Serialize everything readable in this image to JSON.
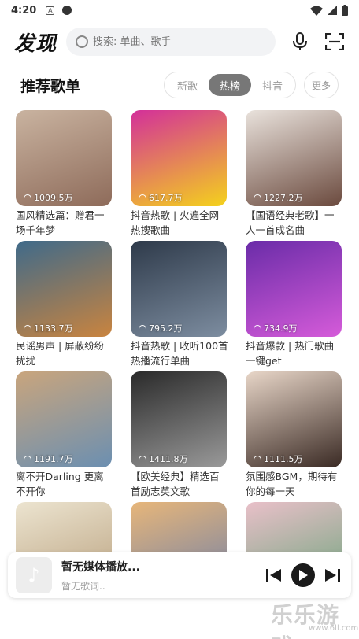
{
  "status": {
    "time": "4:20",
    "a_badge": "A"
  },
  "header": {
    "title": "发现",
    "search_placeholder": "搜索: 单曲、歌手"
  },
  "section": {
    "title": "推荐歌单",
    "tabs": [
      "新歌",
      "热榜",
      "抖音"
    ],
    "active_tab": "热榜",
    "more": "更多"
  },
  "playlists": [
    {
      "plays": "1009.5万",
      "title": "国风精选篇：赠君一场千年梦",
      "colors": [
        "#c9b3a0",
        "#8e6b5a"
      ]
    },
    {
      "plays": "617.7万",
      "title": "抖音热歌 | 火遍全网热搜歌曲",
      "colors": [
        "#d32f9a",
        "#f4d21c"
      ]
    },
    {
      "plays": "1227.2万",
      "title": "【国语经典老歌】一人一首成名曲",
      "colors": [
        "#e9e2dc",
        "#6b4a3e"
      ]
    },
    {
      "plays": "1133.7万",
      "title": "民谣男声 | 屏蔽纷纷扰扰",
      "colors": [
        "#3f6a8a",
        "#c9843f"
      ]
    },
    {
      "plays": "795.2万",
      "title": "抖音热歌 | 收听100首热播流行单曲",
      "colors": [
        "#2e3a4a",
        "#7d8da0"
      ]
    },
    {
      "plays": "734.9万",
      "title": "抖音爆款 | 热门歌曲一键get",
      "colors": [
        "#6a2ca8",
        "#d55bd9"
      ]
    },
    {
      "plays": "1191.7万",
      "title": "离不开Darling 更离不开你",
      "colors": [
        "#c9a57d",
        "#6b8fb1"
      ]
    },
    {
      "plays": "1411.8万",
      "title": "【欧美经典】精选百首励志英文歌",
      "colors": [
        "#2a2a2a",
        "#9a9a9a"
      ]
    },
    {
      "plays": "1111.5万",
      "title": "氛围感BGM，期待有你的每一天",
      "colors": [
        "#e8d6c8",
        "#3a2a24"
      ]
    },
    {
      "plays": "",
      "title": "",
      "colors": [
        "#ece4d0",
        "#b89f7c"
      ]
    },
    {
      "plays": "",
      "title": "",
      "colors": [
        "#e7b67a",
        "#6f7fa7"
      ]
    },
    {
      "plays": "",
      "title": "",
      "colors": [
        "#e9c0c9",
        "#6aa37a"
      ]
    }
  ],
  "player": {
    "song": "暂无媒体播放...",
    "lyric": "暂无歌词.."
  },
  "watermark": {
    "main": "乐乐游戏",
    "sub": "www.6ll.com"
  }
}
